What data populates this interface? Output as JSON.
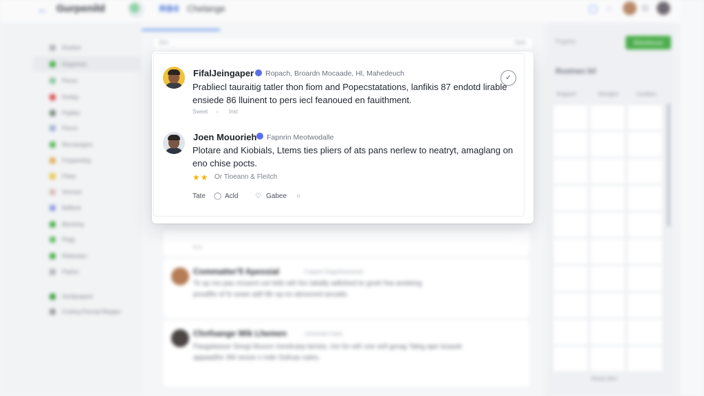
{
  "topbar": {
    "back_icon": "arrow-left-icon",
    "brand": "Gurpenild",
    "badge": "RB0",
    "page_name": "Chelange",
    "icons": [
      "message-icon",
      "bell-icon",
      "settings-icon"
    ]
  },
  "sidebar": {
    "items": [
      {
        "label": "Resttod",
        "color": "#b0b4ba"
      },
      {
        "label": "Degsessa",
        "color": "#4caf50"
      },
      {
        "label": "Pecau",
        "color": "#8bc49a"
      },
      {
        "label": "Kimlap",
        "color": "#e05252"
      },
      {
        "label": "Popliee",
        "color": "#7a8a7e"
      },
      {
        "label": "Pecoo",
        "color": "#9bb4d8"
      },
      {
        "label": "Recsasagne",
        "color": "#5cb85c"
      },
      {
        "label": "Fergsenting",
        "color": "#e0b05a"
      },
      {
        "label": "Fleep",
        "color": "#e6c84a"
      },
      {
        "label": "Vennasl",
        "color": "#d8b9b9"
      },
      {
        "label": "Baflarat",
        "color": "#8f9de0"
      },
      {
        "label": "Baresing",
        "color": "#4caf50"
      },
      {
        "label": "Pegg",
        "color": "#66bb6a"
      },
      {
        "label": "Rebesaan",
        "color": "#4caf50"
      },
      {
        "label": "Peplse",
        "color": "#b0b4ba"
      },
      {
        "label": "Genfpsapeni",
        "color": "#43a047"
      },
      {
        "label": "Cesting Pesnad Bepgen",
        "color": "#9e9e9e"
      }
    ]
  },
  "main": {
    "toolbar": {
      "left": "Sinn",
      "right": "Ssee"
    },
    "comments_bg": [
      {
        "name": "Commatter'll Apessial",
        "tag": "Fopperl Degerfoesseset",
        "line1": "To sp me pau ressent ust lekk wih fon tatially adlished te goolr fow ansleing",
        "line2": "posaflio of fo sowe adil tile op eo atesoned ancatie."
      },
      {
        "name": "Chnfsange Wik Lhemen",
        "tag": "Lhonmaa Ceprt",
        "line1": "Pasgatasiue Seegt Muoon mesticarp lanisis, Ine for wih soe sell gerag Taleg ape tssaule",
        "line2": "appaadhe 3W sesse s mde Ssilcas cales."
      }
    ]
  },
  "popup": {
    "comment1": {
      "name": "FifalJeingaper",
      "meta": "Ropach, Broardn Mocaade, Hl, Mahedeuch",
      "body": "Prabliecl tauraitig tatler thon fiom and Popecstatations, lanfikis 87 endotd lirable ensiede 86 lluinent to pers iecl feanoued en fauithment.",
      "sub1": "Sweet",
      "sub2": "Inst"
    },
    "comment2": {
      "name": "Joen Mouorieh",
      "meta": "Fapnrin Meotwodalle",
      "body": "Plotare and Kiobials, Ltems ties pliers of ats pans nerlew to neatryt, amaglang on eno chise pocts.",
      "stars": "★★",
      "rating_label": "Or Tioeann & Fleitch",
      "actions": [
        "Tate",
        "Acld",
        "Gabee"
      ]
    }
  },
  "rightpanel": {
    "search": "Pugetes",
    "button": "Bhbeblesed",
    "title": "Rustnes kil",
    "headers": [
      "Bragssnf",
      "Nesngise",
      "Cusdises"
    ],
    "footer": "Reaub abes"
  }
}
